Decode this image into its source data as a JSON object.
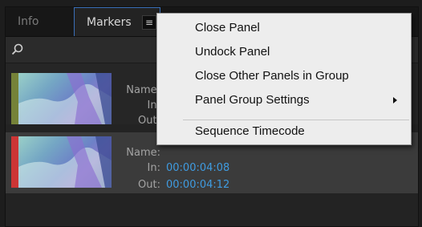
{
  "tabs": [
    {
      "label": "Info"
    },
    {
      "label": "Markers"
    }
  ],
  "panel_menu_icon": "hamburger-icon",
  "search": {
    "icon": "search-icon"
  },
  "markers": [
    {
      "color": "#758238",
      "name_label": "Name:",
      "in_label": "In:",
      "out_label": "Out:",
      "in_value": "",
      "out_value": ""
    },
    {
      "color": "#cc3535",
      "name_label": "Name:",
      "in_label": "In:",
      "out_label": "Out:",
      "in_value": "00:00:04:08",
      "out_value": "00:00:04:12"
    }
  ],
  "context_menu": {
    "items": [
      {
        "label": "Close Panel"
      },
      {
        "label": "Undock Panel"
      },
      {
        "label": "Close Other Panels in Group"
      },
      {
        "label": "Panel Group Settings",
        "submenu": true
      },
      {
        "label": "Sequence Timecode"
      }
    ]
  }
}
